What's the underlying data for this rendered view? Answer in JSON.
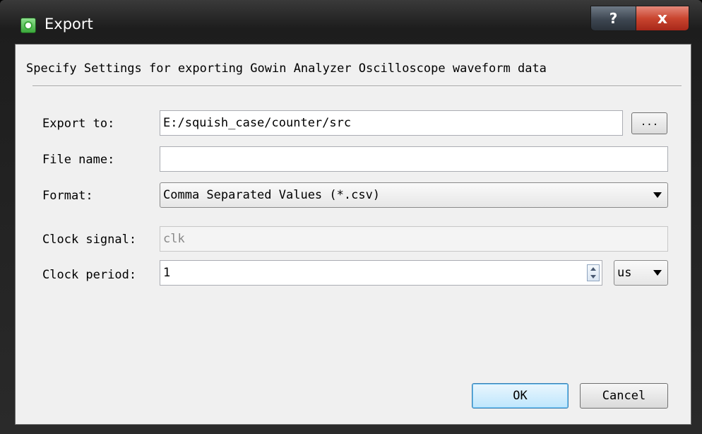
{
  "window": {
    "title": "Export",
    "help_glyph": "?",
    "close_glyph": "x",
    "app_icon": "gowin-app-icon"
  },
  "dialog": {
    "header": "Specify Settings for exporting Gowin Analyzer Oscilloscope waveform data",
    "export_to": {
      "label": "Export to:",
      "value": "E:/squish_case/counter/src",
      "browse_label": "..."
    },
    "file_name": {
      "label": "File name:",
      "value": ""
    },
    "format": {
      "label": "Format:",
      "selected": "Comma Separated Values (*.csv)"
    },
    "clock_signal": {
      "label": "Clock signal:",
      "value": "clk"
    },
    "clock_period": {
      "label": "Clock period:",
      "value": "1",
      "unit": "us"
    },
    "buttons": {
      "ok": "OK",
      "cancel": "Cancel"
    }
  }
}
